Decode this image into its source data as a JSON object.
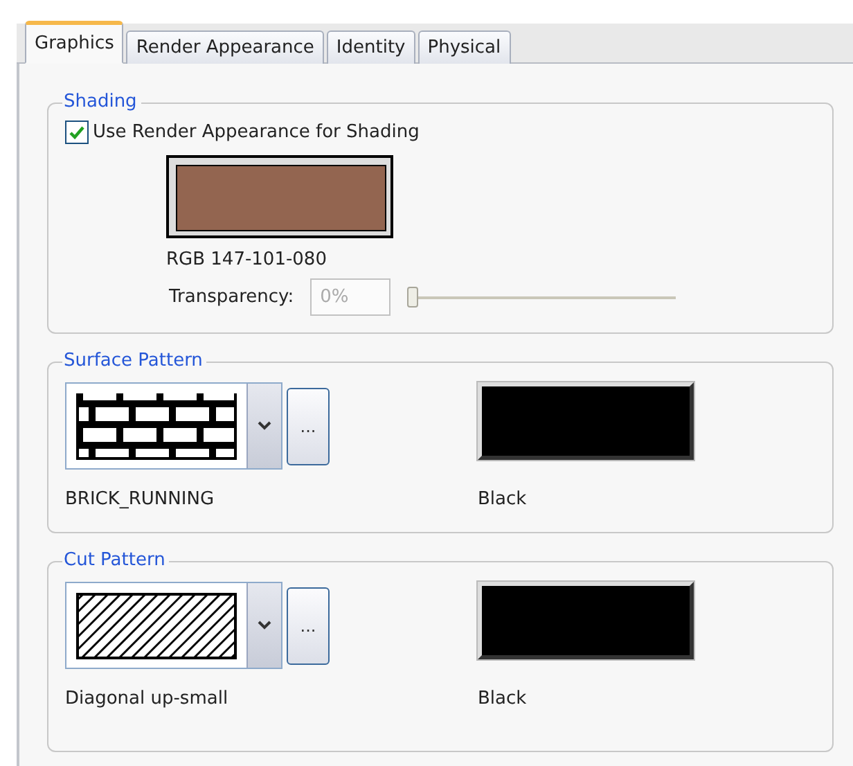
{
  "tabs": [
    {
      "label": "Graphics",
      "selected": true
    },
    {
      "label": "Render Appearance",
      "selected": false
    },
    {
      "label": "Identity",
      "selected": false
    },
    {
      "label": "Physical",
      "selected": false
    }
  ],
  "shading": {
    "title": "Shading",
    "use_render_appearance": {
      "label": "Use Render Appearance for Shading",
      "checked": true
    },
    "color": "#936550",
    "color_label": "RGB 147-101-080",
    "transparency": {
      "label": "Transparency:",
      "value": "0%",
      "level": 0
    }
  },
  "patterns": [
    {
      "title": "Surface Pattern",
      "kind": "brick",
      "name": "BRICK_RUNNING",
      "browse": "...",
      "color": "#000000",
      "color_label": "Black"
    },
    {
      "title": "Cut Pattern",
      "kind": "diagonal",
      "name": "Diagonal up-small",
      "browse": "...",
      "color": "#000000",
      "color_label": "Black"
    }
  ]
}
